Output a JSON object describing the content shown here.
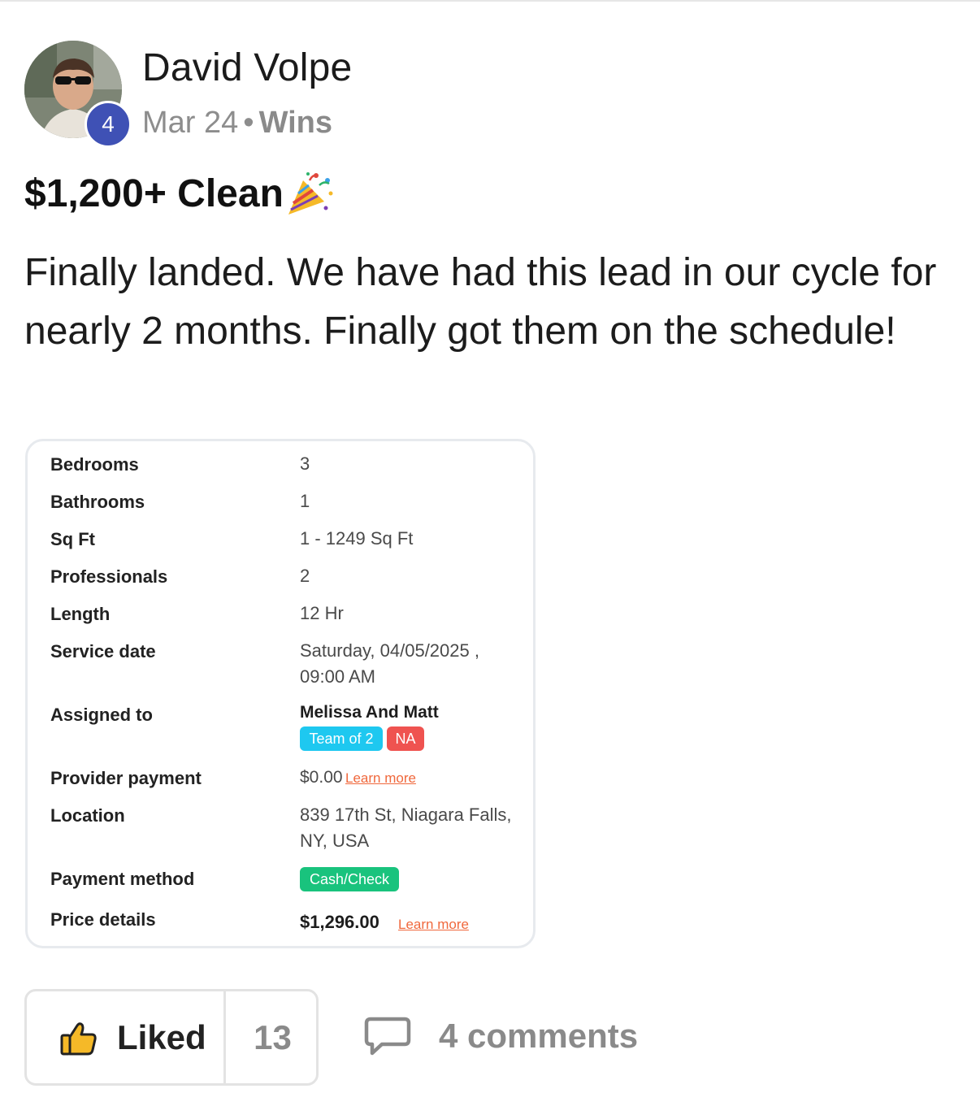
{
  "post": {
    "author": "David Volpe",
    "level": "4",
    "date": "Mar 24",
    "separator": "•",
    "category": "Wins",
    "title": "$1,200+ Clean",
    "body": "Finally landed. We have had this lead in our cycle for nearly 2 months. Finally got them on the schedule!"
  },
  "booking": {
    "rows": [
      {
        "label": "Bedrooms",
        "value": "3"
      },
      {
        "label": "Bathrooms",
        "value": "1"
      },
      {
        "label": "Sq Ft",
        "value": "1 - 1249 Sq Ft"
      },
      {
        "label": "Professionals",
        "value": "2"
      },
      {
        "label": "Length",
        "value": "12 Hr"
      },
      {
        "label": "Service date",
        "value_line1": "Saturday, 04/05/2025 ,",
        "value_line2": "09:00 AM"
      },
      {
        "label": "Assigned to",
        "value": "Melissa And Matt",
        "tags": [
          "Team of 2",
          "NA"
        ]
      },
      {
        "label": "Provider payment",
        "value": "$0.00",
        "link": "Learn more"
      },
      {
        "label": "Location",
        "value_line1": "839 17th St, Niagara Falls,",
        "value_line2": "NY, USA"
      },
      {
        "label": "Payment method",
        "tag": "Cash/Check"
      },
      {
        "label": "Price details",
        "value": "$1,296.00",
        "link": "Learn more"
      }
    ]
  },
  "actions": {
    "like_label": "Liked",
    "like_count": "13",
    "comments_label": "4 comments"
  },
  "icons": {
    "title_emoji": "party-popper-icon",
    "like": "thumbs-up-icon",
    "comments": "comment-bubble-icon"
  },
  "colors": {
    "level_badge": "#3f51b5",
    "team_tag": "#1ec8f0",
    "na_tag": "#ef5350",
    "payment_tag": "#19c37d",
    "link": "#f0683c",
    "like_icon": "#f5b928"
  }
}
